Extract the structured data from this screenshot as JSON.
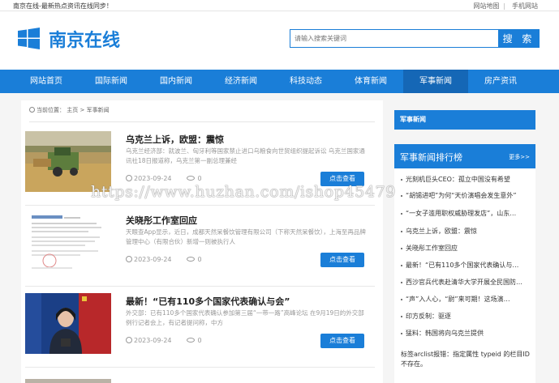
{
  "topbar": {
    "tagline": "南京在线-最新热点资讯在线同步！",
    "links": [
      "网站地图",
      "手机网站"
    ]
  },
  "header": {
    "logo_text": "南京在线",
    "search_placeholder": "请输入搜索关键词",
    "search_button": "搜 索"
  },
  "nav": {
    "items": [
      "网站首页",
      "国际新闻",
      "国内新闻",
      "经济新闻",
      "科技动态",
      "体育新闻",
      "军事新闻",
      "房产资讯"
    ],
    "active": "军事新闻"
  },
  "breadcrumb": {
    "label": "当前位置：",
    "home": "主页",
    "sep": ">",
    "current": "军事新闻"
  },
  "articles": [
    {
      "title": "乌克兰上诉，欧盟：震惊",
      "summary": "乌克兰经济部：就波兰、匈牙利等国家禁止进口乌粮食向世贸组织提起诉讼 乌克兰国家通讯社18日报道称，乌克兰第一副总理兼经",
      "date": "2023-09-24",
      "views": "0",
      "button": "点击查看"
    },
    {
      "title": "关晓彤工作室回应",
      "summary": "天眼查App显示，近日，成都天然呆餐饮管理有限公司（下称天然呆餐饮），上海至再品牌管理中心（有限合伙）新增一则被执行人",
      "date": "2023-09-24",
      "views": "0",
      "button": "点击查看"
    },
    {
      "title": "最新！“已有110多个国家代表确认与会”",
      "summary": "外交部：已有110多个国家代表确认参加第三届“一带一路”高峰论坛 在9月19日的外交部例行记者会上，有记者提问称，中方",
      "date": "2023-09-24",
      "views": "0",
      "button": "点击查看"
    }
  ],
  "sidebar": {
    "box_title": "军事新闻",
    "rank_title": "军事新闻排行榜",
    "more": "更多>>",
    "items": [
      "光刻机巨头CEO：孤立中国没有希望",
      "“胡锡进吧”为何“天价演唱会发生意外”",
      "“一女子滥用职权威胁理发店”，山东…",
      "乌克兰上诉，欧盟：震惊",
      "关晓彤工作室回应",
      "最新！“已有110多个国家代表确认与…",
      "西沙官兵代表赴清华大学开展全民国防…",
      "“声”入人心，“尉”来可期！这场演…",
      "印方反制：驱逐",
      "猛料：韩国将向乌克兰提供"
    ],
    "tip": "标签arclist报错：指定属性 typeid 的栏目ID不存在。"
  },
  "watermark": "https://www.huzhan.com/ishop45479",
  "colors": {
    "brand_blue": "#1a7ed8",
    "nav_active": "#1567b6"
  }
}
